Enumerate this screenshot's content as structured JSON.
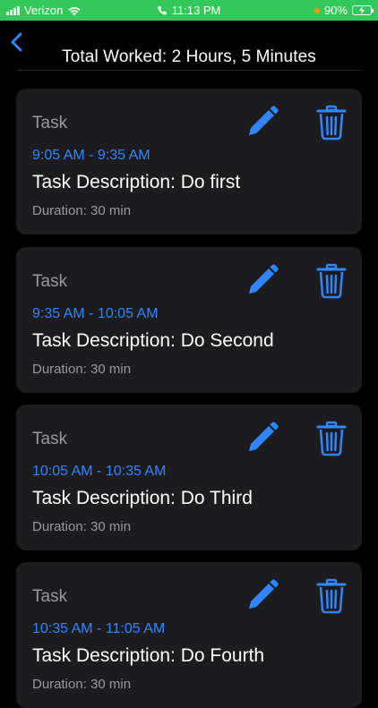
{
  "status_bar": {
    "carrier": "Verizon",
    "time": "11:13 PM",
    "battery": "90%"
  },
  "nav": {
    "title": "Total Worked: 2 Hours, 5 Minutes"
  },
  "tasks": [
    {
      "heading": "Task",
      "time_range": "9:05 AM - 9:35 AM",
      "description": "Task Description: Do first",
      "duration": "Duration: 30 min"
    },
    {
      "heading": "Task",
      "time_range": "9:35 AM - 10:05 AM",
      "description": "Task Description: Do Second",
      "duration": "Duration: 30 min"
    },
    {
      "heading": "Task",
      "time_range": "10:05 AM - 10:35 AM",
      "description": "Task Description: Do Third",
      "duration": "Duration: 30 min"
    },
    {
      "heading": "Task",
      "time_range": "10:35 AM - 11:05 AM",
      "description": "Task Description: Do Fourth",
      "duration": "Duration: 30 min"
    }
  ],
  "icons": {
    "back": "chevron-left-icon",
    "edit": "pencil-icon",
    "delete": "trash-icon"
  },
  "colors": {
    "accent": "#2f86ff",
    "status_bar": "#34c759",
    "card": "#1c1c1e",
    "secondary_text": "#98989d"
  }
}
